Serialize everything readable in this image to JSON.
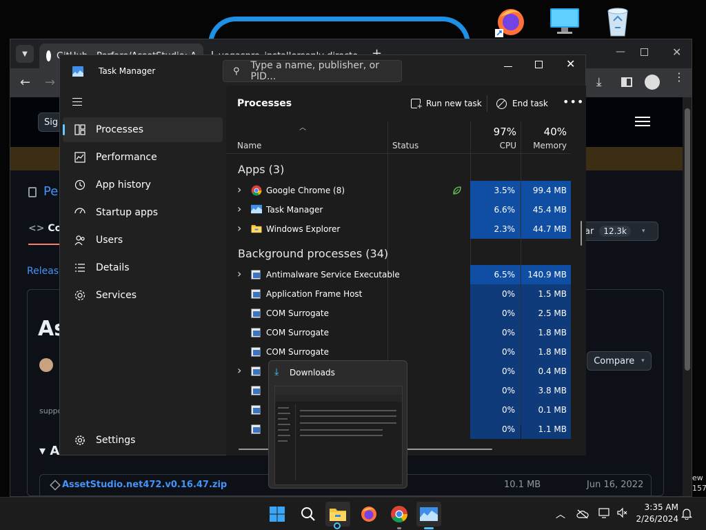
{
  "chrome": {
    "tab1_title": "GitHub - Perfare/AssetStudio: A",
    "tab2_title": "vegaspro_installersonly directo",
    "signin_label": "Sig",
    "repo_name_partial": "Pe",
    "code_tab_partial": "Co",
    "releases_partial": "Release",
    "release_title_partial": "As",
    "star_label_partial": "ar",
    "star_count": "12.3k",
    "compare_label": "Compare",
    "support_partial": "suppo",
    "assets_partial": "Ass",
    "asset_file": "AssetStudio.net472.v0.16.47.zip",
    "asset_size": "10.1 MB",
    "asset_date": "Jun 16, 2022",
    "edge_text_1": "ew",
    "edge_text_2": "157"
  },
  "taskmanager": {
    "title": "Task Manager",
    "search_placeholder": "Type a name, publisher, or PID...",
    "nav": [
      {
        "label": "Processes",
        "icon": "processes-icon"
      },
      {
        "label": "Performance",
        "icon": "performance-icon"
      },
      {
        "label": "App history",
        "icon": "app-history-icon"
      },
      {
        "label": "Startup apps",
        "icon": "startup-apps-icon"
      },
      {
        "label": "Users",
        "icon": "users-icon"
      },
      {
        "label": "Details",
        "icon": "details-icon"
      },
      {
        "label": "Services",
        "icon": "services-icon"
      }
    ],
    "settings_label": "Settings",
    "page_title": "Processes",
    "run_new_task": "Run new task",
    "end_task": "End task",
    "columns": {
      "name": "Name",
      "status": "Status",
      "cpu_pct": "97%",
      "cpu": "CPU",
      "mem_pct": "40%",
      "memory": "Memory"
    },
    "apps_header": "Apps (3)",
    "apps": [
      {
        "name": "Google Chrome (8)",
        "cpu": "3.5%",
        "mem": "99.4 MB"
      },
      {
        "name": "Task Manager",
        "cpu": "6.6%",
        "mem": "45.4 MB"
      },
      {
        "name": "Windows Explorer",
        "cpu": "2.3%",
        "mem": "44.7 MB"
      }
    ],
    "bg_header": "Background processes (34)",
    "bg": [
      {
        "name": "Antimalware Service Executable",
        "cpu": "6.5%",
        "mem": "140.9 MB"
      },
      {
        "name": "Application Frame Host",
        "cpu": "0%",
        "mem": "1.5 MB"
      },
      {
        "name": "COM Surrogate",
        "cpu": "0%",
        "mem": "2.5 MB"
      },
      {
        "name": "COM Surrogate",
        "cpu": "0%",
        "mem": "1.8 MB"
      },
      {
        "name": "COM Surrogate",
        "cpu": "0%",
        "mem": "1.8 MB"
      },
      {
        "name": "",
        "cpu": "0%",
        "mem": "0.4 MB"
      },
      {
        "name": "",
        "cpu": "0%",
        "mem": "3.8 MB"
      },
      {
        "name": "",
        "cpu": "0%",
        "mem": "0.1 MB"
      },
      {
        "name": "",
        "cpu": "0%",
        "mem": "1.1 MB"
      }
    ]
  },
  "thumbnail": {
    "title": "Downloads"
  },
  "taskbar": {
    "time": "3:35 AM",
    "date": "2/26/2024"
  },
  "colors": {
    "accent": "#60cdff",
    "cpu_high": "#0f4ea3",
    "cpu_low": "#0f3b7a",
    "window_bg": "#202020"
  }
}
